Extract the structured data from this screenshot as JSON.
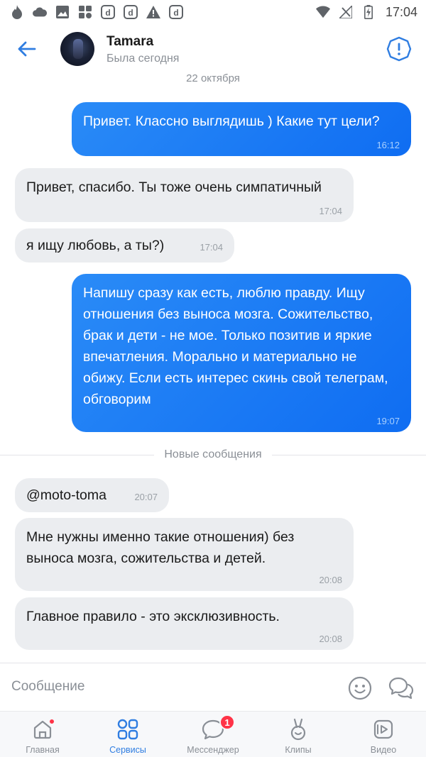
{
  "status_bar": {
    "time": "17:04",
    "left_icons": [
      "flame-icon",
      "cloud-icon",
      "image-icon",
      "apps-icon",
      "app-d-icon",
      "app-d-icon",
      "warning-icon",
      "app-d-icon"
    ],
    "right_icons": [
      "wifi-icon",
      "no-signal-icon",
      "battery-charging-icon"
    ]
  },
  "header": {
    "contact_name": "Tamara",
    "contact_status": "Была сегодня"
  },
  "chat": {
    "date_divider": "22 октября",
    "new_messages_label": "Новые сообщения",
    "messages": [
      {
        "direction": "out",
        "text": "Привет. Классно выглядишь ) Какие тут цели?",
        "time": "16:12"
      },
      {
        "direction": "in",
        "text": "Привет, спасибо. Ты тоже очень симпатичный",
        "time": "17:04"
      },
      {
        "direction": "in",
        "text": "я ищу любовь, а ты?)",
        "time": "17:04"
      },
      {
        "direction": "out",
        "text": "Напишу сразу как есть, люблю правду. Ищу отношения без выноса мозга. Сожительство, брак и дети - не мое. Только позитив и яркие впечатления. Морально и материально не обижу. Если есть интерес скинь свой телеграм, обговорим",
        "time": "19:07"
      },
      {
        "direction": "in",
        "text": "@moto-toma",
        "time": "20:07"
      },
      {
        "direction": "in",
        "text": "Мне нужны именно такие отношения) без выноса мозга, сожительства и детей.",
        "time": "20:08"
      },
      {
        "direction": "in",
        "text": "Главное правило - это эксклюзивность.",
        "time": "20:08"
      }
    ]
  },
  "composer": {
    "placeholder": "Сообщение"
  },
  "bottom_nav": {
    "items": [
      {
        "label": "Главная",
        "icon": "home-icon"
      },
      {
        "label": "Сервисы",
        "icon": "services-icon",
        "active": true
      },
      {
        "label": "Мессенджер",
        "icon": "messenger-icon",
        "badge": "1"
      },
      {
        "label": "Клипы",
        "icon": "clips-icon"
      },
      {
        "label": "Видео",
        "icon": "video-icon"
      }
    ]
  },
  "colors": {
    "accent": "#2f7de1",
    "outgoing_bubble": "#0f6df2",
    "incoming_bubble": "#ebedf0",
    "badge": "#ff3347"
  }
}
